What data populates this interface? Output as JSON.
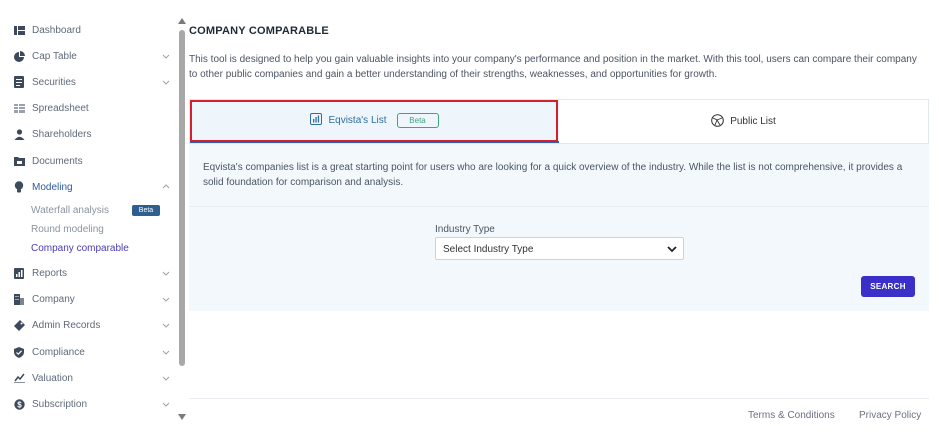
{
  "sidebar": {
    "items": [
      {
        "label": "Dashboard",
        "icon": "dashboard-icon"
      },
      {
        "label": "Cap Table",
        "icon": "pie-chart-icon"
      },
      {
        "label": "Securities",
        "icon": "securities-icon"
      },
      {
        "label": "Spreadsheet",
        "icon": "spreadsheet-icon"
      },
      {
        "label": "Shareholders",
        "icon": "user-icon"
      },
      {
        "label": "Documents",
        "icon": "documents-icon"
      },
      {
        "label": "Modeling",
        "icon": "lightbulb-icon"
      },
      {
        "label": "Reports",
        "icon": "reports-icon"
      },
      {
        "label": "Company",
        "icon": "building-icon"
      },
      {
        "label": "Admin Records",
        "icon": "admin-records-icon"
      },
      {
        "label": "Compliance",
        "icon": "shield-check-icon"
      },
      {
        "label": "Valuation",
        "icon": "valuation-icon"
      },
      {
        "label": "Subscription",
        "icon": "subscription-icon"
      }
    ],
    "modeling_sub": {
      "waterfall": "Waterfall analysis",
      "waterfall_badge": "Beta",
      "round": "Round modeling",
      "comparable": "Company comparable"
    }
  },
  "main": {
    "title": "COMPANY COMPARABLE",
    "intro": "This tool is designed to help you gain valuable insights into your company's performance and position in the market. With this tool, users can compare their company to other public companies and gain a better understanding of their strengths, weaknesses, and opportunities for growth.",
    "tabs": {
      "eqvista": "Eqvista's List",
      "eqvista_badge": "Beta",
      "public": "Public List"
    },
    "panel": {
      "description": "Eqvista's companies list is a great starting point for users who are looking for a quick overview of the industry. While the list is not comprehensive, it provides a solid foundation for comparison and analysis.",
      "industry_label": "Industry Type",
      "industry_value": "Select Industry Type",
      "search": "SEARCH"
    }
  },
  "footer": {
    "terms": "Terms & Conditions",
    "privacy": "Privacy Policy"
  },
  "colors": {
    "accent": "#3b2fc9",
    "active_link": "#4a3bb5",
    "tab_active_border": "#2f5fa8",
    "highlight": "#d32030",
    "badge_green": "#3fa37f"
  }
}
